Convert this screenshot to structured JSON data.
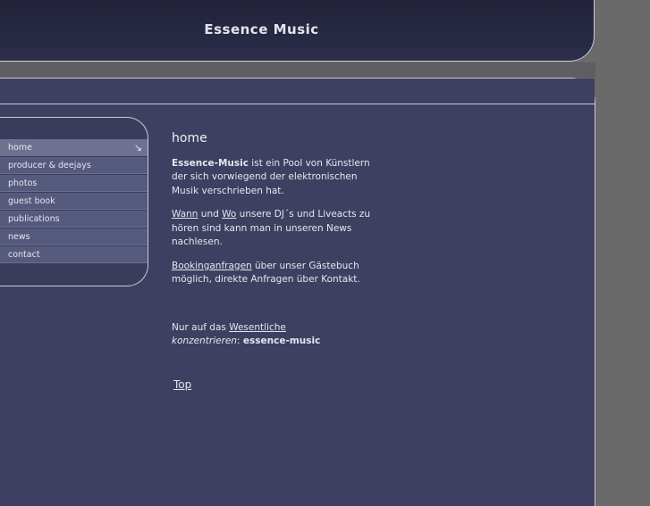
{
  "header": {
    "title": "Essence Music"
  },
  "nav": {
    "items": [
      {
        "label": "home",
        "arrow": "↘"
      },
      {
        "label": "producer & deejays"
      },
      {
        "label": "photos"
      },
      {
        "label": "guest book"
      },
      {
        "label": "publications"
      },
      {
        "label": "news"
      },
      {
        "label": "contact"
      }
    ]
  },
  "main": {
    "heading": "home",
    "p1": {
      "strong": "Essence-Music",
      "text": " ist ein Pool von Künstlern der sich vorwiegend der elektronischen Musik verschrieben hat."
    },
    "p2": {
      "link1": "Wann",
      "and": " und ",
      "link2": "Wo",
      "text": " unsere DJ´s und Liveacts zu hören sind kann man in unseren News nachlesen."
    },
    "p3": {
      "link": "Bookinganfragen",
      "text": " über unser Gästebuch möglich, direkte Anfragen über Kontakt."
    },
    "p4": {
      "prefix": "Nur auf das ",
      "link": "Wesentliche",
      "emph": "konzentrieren",
      "colon": ": ",
      "strong": "essence-music"
    }
  },
  "footer": {
    "top_link": "Top"
  },
  "colors": {
    "background": "#6a6a6a",
    "header": "#262842",
    "content": "#3e4061",
    "nav_item": "#565a7d",
    "nav_active": "#6e7290"
  }
}
